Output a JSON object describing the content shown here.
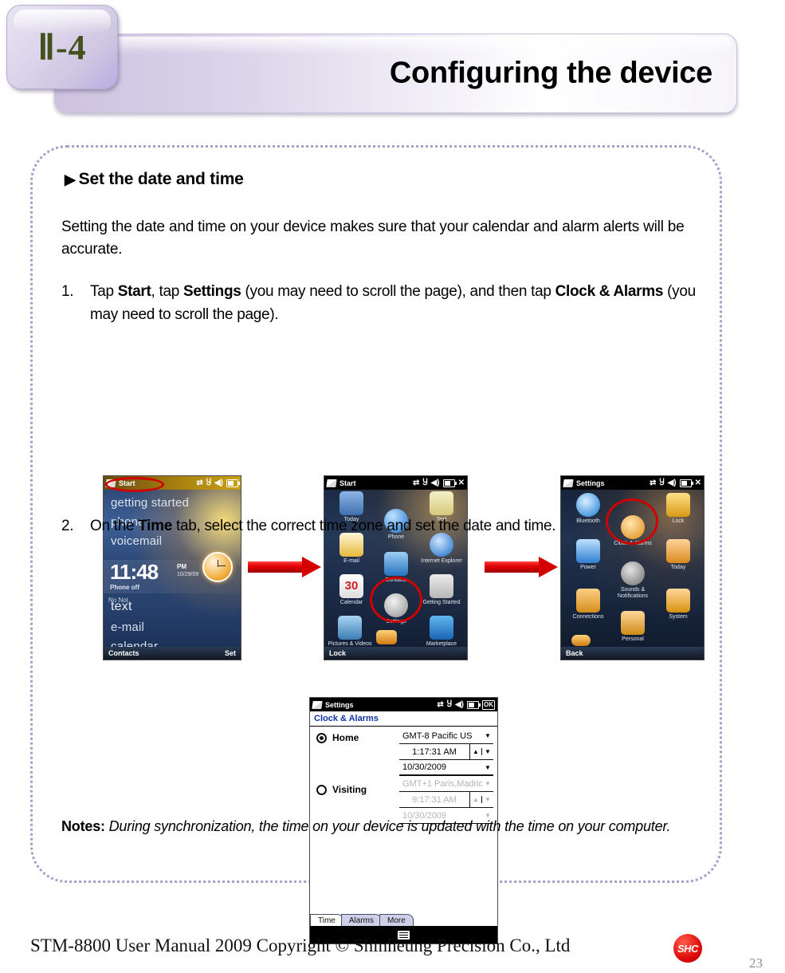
{
  "header": {
    "chapter_label": "Ⅱ-4",
    "title": "Configuring the device",
    "chapter_color": "#44511f"
  },
  "content": {
    "section_title": "Set the date and time",
    "section_bullet": "▶",
    "intro": "Setting the date and time on your device makes sure that your calendar and alarm alerts will be accurate.",
    "steps": [
      {
        "number": "1.",
        "text_parts": [
          "Tap ",
          "Start",
          ", tap ",
          "Settings",
          " (you may need to scroll the page), and then tap ",
          "Clock & Alarms",
          " (you may need to scroll the page)."
        ]
      },
      {
        "number": "2.",
        "text_parts": [
          "On the ",
          "Time",
          " tab, select the correct time zone and set the date and time."
        ]
      }
    ],
    "step1_full": "Tap Start, tap Settings (you may need to scroll the page), and then tap Clock & Alarms (you may need to scroll the page).",
    "step2_full": "On the Time tab, select the correct time zone and set the date and time.",
    "notes_label": "Notes:",
    "notes_text": "During synchronization, the time on your device is updated with the time on your computer."
  },
  "screenshots": {
    "today": {
      "status_title": "Start",
      "status_icons": [
        "connectivity-icon",
        "signal-off-icon",
        "speaker-icon",
        "battery-icon"
      ],
      "items": [
        "getting started",
        "phone",
        "voicemail"
      ],
      "time": "11:48",
      "ampm": "PM",
      "date": "10/29/09",
      "phone_status": "Phone off",
      "notifications": "No Not.",
      "items_lower": [
        "text",
        "e-mail",
        "calendar"
      ],
      "softkey_left": "Contacts",
      "softkey_right": "Set"
    },
    "start_menu": {
      "status_title": "Start",
      "status_icons": [
        "connectivity-icon",
        "signal-off-icon",
        "speaker-icon",
        "battery-icon",
        "close-icon"
      ],
      "tiles": [
        "Today",
        "Text",
        "Phone",
        "E-mail",
        "Internet Explorer",
        "Contacts",
        "Calendar",
        "Getting Started",
        "Settings",
        "Pictures & Videos",
        "Marketplace"
      ],
      "calendar_day": "30",
      "highlighted": "Settings",
      "softkey_left": "Lock"
    },
    "settings": {
      "status_title": "Settings",
      "status_icons": [
        "connectivity-icon",
        "signal-off-icon",
        "speaker-icon",
        "battery-icon",
        "close-icon"
      ],
      "tiles": [
        "Bluetooth",
        "Lock",
        "Clock & Alarms",
        "Power",
        "Today",
        "Sounds & Notifications",
        "Connections",
        "System",
        "Personal"
      ],
      "highlighted": "Clock & Alarms",
      "softkey_left": "Back"
    },
    "clock_alarms": {
      "status_title": "Settings",
      "status_ok": "OK",
      "status_icons": [
        "connectivity-icon",
        "signal-off-icon",
        "speaker-icon",
        "battery-icon",
        "ok-button"
      ],
      "page_title": "Clock & Alarms",
      "home_label": "Home",
      "home_selected": true,
      "home_timezone": "GMT-8 Pacific US",
      "home_time": "1:17:31 AM",
      "home_date": "10/30/2009",
      "visiting_label": "Visiting",
      "visiting_selected": false,
      "visiting_timezone": "GMT+1 Paris,Madrid",
      "visiting_time": "9:17:31 AM",
      "visiting_date": "10/30/2009",
      "tabs": [
        "Time",
        "Alarms",
        "More"
      ],
      "active_tab": "Time",
      "keyboard_icon": "keyboard-icon"
    }
  },
  "footer": {
    "text": "STM-8800 User Manual  2009 Copyright © Shinheung Precision Co., Ltd",
    "logo_text": "SHC",
    "page_number": "23"
  }
}
